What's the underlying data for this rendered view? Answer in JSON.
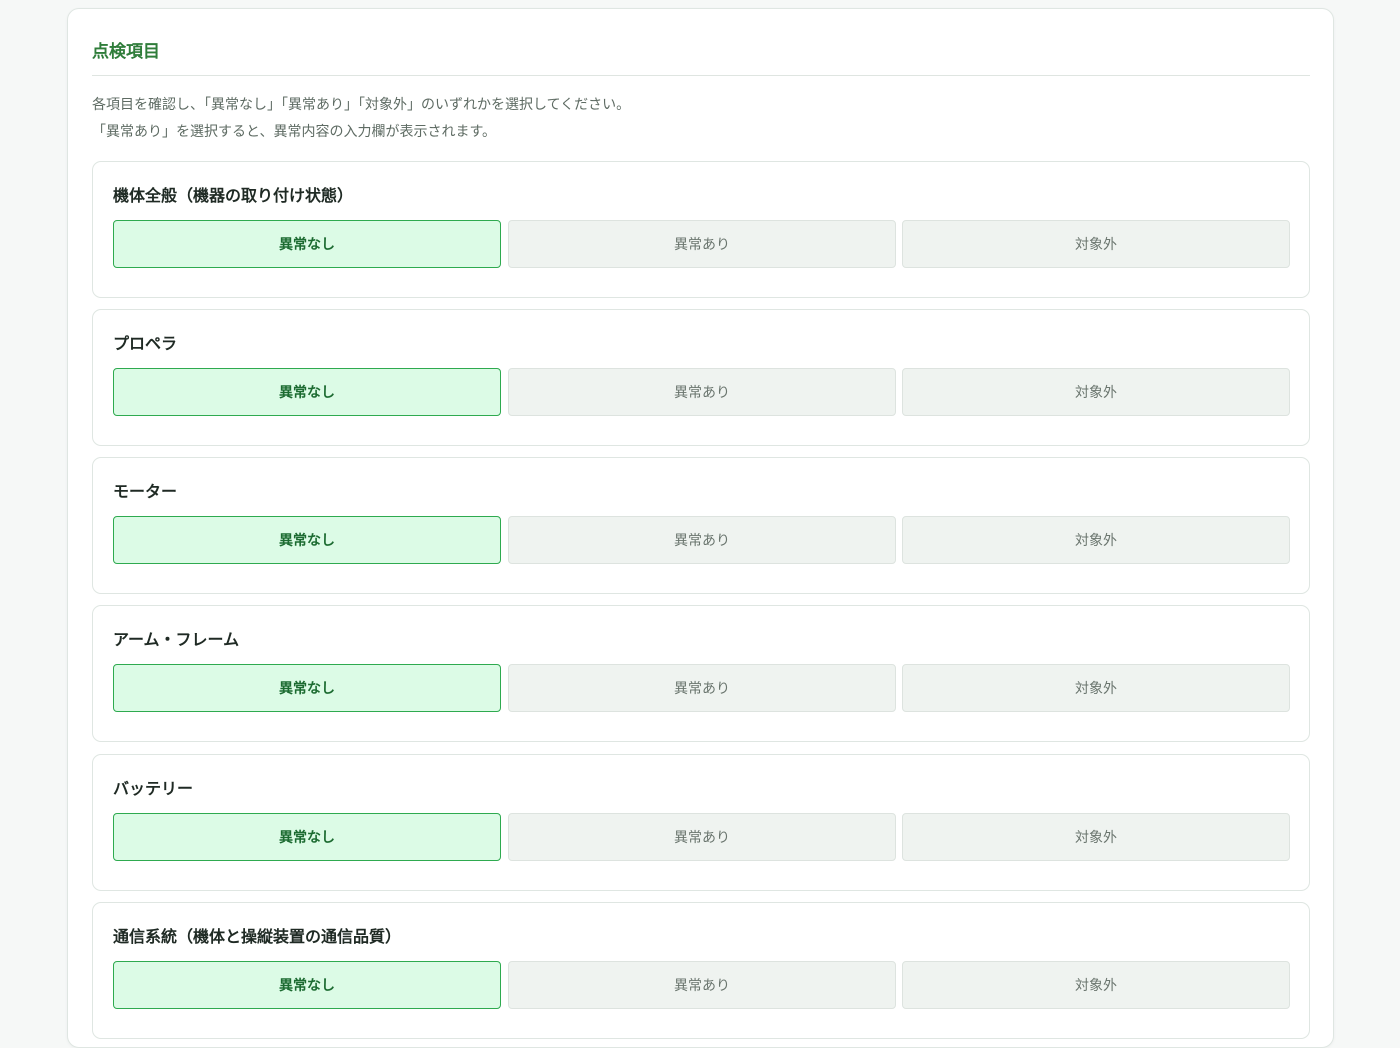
{
  "section": {
    "title": "点検項目",
    "description_line1": "各項目を確認し、「異常なし」「異常あり」「対象外」のいずれかを選択してください。",
    "description_line2": "「異常あり」を選択すると、異常内容の入力欄が表示されます。"
  },
  "options": [
    "異常なし",
    "異常あり",
    "対象外"
  ],
  "items": [
    {
      "label": "機体全般（機器の取り付け状態）",
      "selected": "異常なし"
    },
    {
      "label": "プロペラ",
      "selected": "異常なし"
    },
    {
      "label": "モーター",
      "selected": "異常なし"
    },
    {
      "label": "アーム・フレーム",
      "selected": "異常なし"
    },
    {
      "label": "バッテリー",
      "selected": "異常なし"
    },
    {
      "label": "通信系統（機体と操縦装置の通信品質）",
      "selected": "異常なし"
    }
  ],
  "colors": {
    "accent": "#2f7d3a",
    "selected_bg": "#dcfbe6",
    "selected_border": "#2eaa4f",
    "unselected_bg": "#eff3f0"
  }
}
